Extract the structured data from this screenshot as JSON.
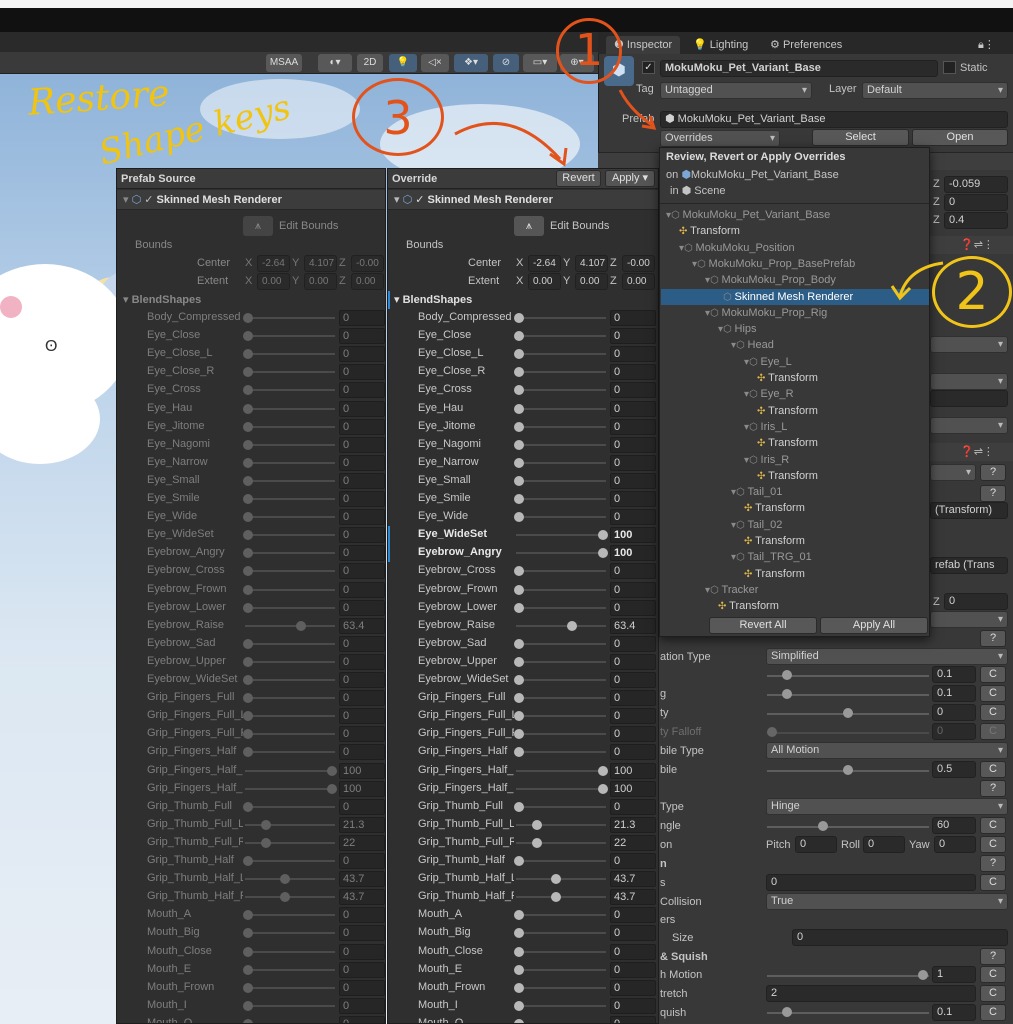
{
  "scene": {
    "toolbar": {
      "msaa": "MSAA",
      "mode_2d": "2D"
    },
    "annotations": {
      "title_line1": "Restore",
      "title_line2": "Shape keys",
      "circle1": "①",
      "circle2": "②",
      "circle3": "③"
    }
  },
  "inspector": {
    "tabs": [
      "Inspector",
      "Lighting",
      "Preferences"
    ],
    "object_name": "MokuMoku_Pet_Variant_Base",
    "static_label": "Static",
    "tag_label": "Tag",
    "tag_value": "Untagged",
    "layer_label": "Layer",
    "layer_value": "Default",
    "prefab_label": "Prefab",
    "prefab_value": "MokuMoku_Pet_Variant_Base",
    "overrides_label": "Overrides",
    "select_label": "Select",
    "open_label": "Open",
    "z_values": [
      "-0.059",
      "0",
      "0.4"
    ],
    "transform_ref_1": "(Transform)",
    "transform_ref_2": "refab (Trans",
    "z_field_label": "Z",
    "z_field_value": "0",
    "rows": [
      {
        "label": "ation Type",
        "dropdown": "Simplified"
      },
      {
        "label": "",
        "value": "0.1"
      },
      {
        "label": "g",
        "value": "0.1"
      },
      {
        "label": "ty",
        "value": "0"
      },
      {
        "label": "ty Falloff",
        "value": "0"
      },
      {
        "label": "bile Type",
        "dropdown": "All Motion"
      },
      {
        "label": "bile",
        "value": "0.5"
      },
      {
        "label": "Type",
        "dropdown": "Hinge"
      },
      {
        "label": "ngle",
        "value": "60"
      },
      {
        "label": "on",
        "pitch": "0",
        "roll": "0",
        "yaw": "0"
      },
      {
        "label": "n"
      },
      {
        "label": "s",
        "value": "0"
      },
      {
        "label": "Collision",
        "dropdown": "True"
      },
      {
        "label": "ers"
      },
      {
        "label": "Size",
        "value": "0"
      },
      {
        "label": "& Squish"
      },
      {
        "label": "h Motion",
        "value": "1"
      },
      {
        "label": "tretch",
        "value": "2"
      },
      {
        "label": "quish",
        "value": "0.1"
      }
    ],
    "pitch_label": "Pitch",
    "roll_label": "Roll",
    "yaw_label": "Yaw",
    "c_label": "C",
    "help": "?"
  },
  "popup": {
    "title": "Review, Revert or Apply Overrides",
    "on_label": "on",
    "on_target": "MokuMoku_Pet_Variant_Base",
    "in_label": "in",
    "in_target": "Scene",
    "tree": [
      {
        "label": "MokuMoku_Pet_Variant_Base",
        "indent": 0,
        "type": "go"
      },
      {
        "label": "Transform",
        "indent": 1,
        "type": "tf"
      },
      {
        "label": "MokuMoku_Position",
        "indent": 1,
        "type": "go"
      },
      {
        "label": "MokuMoku_Prop_BasePrefab",
        "indent": 2,
        "type": "go"
      },
      {
        "label": "MokuMoku_Prop_Body",
        "indent": 3,
        "type": "go"
      },
      {
        "label": "Skinned Mesh Renderer",
        "indent": 4,
        "type": "sel"
      },
      {
        "label": "MokuMoku_Prop_Rig",
        "indent": 3,
        "type": "go"
      },
      {
        "label": "Hips",
        "indent": 4,
        "type": "go"
      },
      {
        "label": "Head",
        "indent": 5,
        "type": "go"
      },
      {
        "label": "Eye_L",
        "indent": 6,
        "type": "go"
      },
      {
        "label": "Transform",
        "indent": 7,
        "type": "tf"
      },
      {
        "label": "Eye_R",
        "indent": 6,
        "type": "go"
      },
      {
        "label": "Transform",
        "indent": 7,
        "type": "tf"
      },
      {
        "label": "Iris_L",
        "indent": 6,
        "type": "go"
      },
      {
        "label": "Transform",
        "indent": 7,
        "type": "tf"
      },
      {
        "label": "Iris_R",
        "indent": 6,
        "type": "go"
      },
      {
        "label": "Transform",
        "indent": 7,
        "type": "tf"
      },
      {
        "label": "Tail_01",
        "indent": 5,
        "type": "go"
      },
      {
        "label": "Transform",
        "indent": 6,
        "type": "tf"
      },
      {
        "label": "Tail_02",
        "indent": 5,
        "type": "go"
      },
      {
        "label": "Transform",
        "indent": 6,
        "type": "tf"
      },
      {
        "label": "Tail_TRG_01",
        "indent": 5,
        "type": "go"
      },
      {
        "label": "Transform",
        "indent": 6,
        "type": "tf"
      },
      {
        "label": "Tracker",
        "indent": 3,
        "type": "go"
      },
      {
        "label": "Transform",
        "indent": 4,
        "type": "tf"
      }
    ],
    "revert_all": "Revert All",
    "apply_all": "Apply All"
  },
  "compare": {
    "source_title": "Prefab Source",
    "override_title": "Override",
    "revert": "Revert",
    "apply": "Apply",
    "component": "Skinned Mesh Renderer",
    "edit_bounds": "Edit Bounds",
    "bounds": "Bounds",
    "center_label": "Center",
    "extent_label": "Extent",
    "x": "X",
    "y": "Y",
    "z": "Z",
    "center": [
      "-2.64",
      "4.107",
      "-0.00"
    ],
    "extent": [
      "0.00",
      "0.00",
      "0.00"
    ],
    "blendshapes_label": "BlendShapes",
    "shapes": [
      {
        "name": "Body_Compressed",
        "src": "0",
        "ovr": "0"
      },
      {
        "name": "Eye_Close",
        "src": "0",
        "ovr": "0"
      },
      {
        "name": "Eye_Close_L",
        "src": "0",
        "ovr": "0"
      },
      {
        "name": "Eye_Close_R",
        "src": "0",
        "ovr": "0"
      },
      {
        "name": "Eye_Cross",
        "src": "0",
        "ovr": "0"
      },
      {
        "name": "Eye_Hau",
        "src": "0",
        "ovr": "0"
      },
      {
        "name": "Eye_Jitome",
        "src": "0",
        "ovr": "0"
      },
      {
        "name": "Eye_Nagomi",
        "src": "0",
        "ovr": "0"
      },
      {
        "name": "Eye_Narrow",
        "src": "0",
        "ovr": "0"
      },
      {
        "name": "Eye_Small",
        "src": "0",
        "ovr": "0"
      },
      {
        "name": "Eye_Smile",
        "src": "0",
        "ovr": "0"
      },
      {
        "name": "Eye_Wide",
        "src": "0",
        "ovr": "0"
      },
      {
        "name": "Eye_WideSet",
        "src": "0",
        "ovr": "100",
        "bold": true
      },
      {
        "name": "Eyebrow_Angry",
        "src": "0",
        "ovr": "100",
        "bold": true
      },
      {
        "name": "Eyebrow_Cross",
        "src": "0",
        "ovr": "0"
      },
      {
        "name": "Eyebrow_Frown",
        "src": "0",
        "ovr": "0"
      },
      {
        "name": "Eyebrow_Lower",
        "src": "0",
        "ovr": "0"
      },
      {
        "name": "Eyebrow_Raise",
        "src": "63.4",
        "ovr": "63.4"
      },
      {
        "name": "Eyebrow_Sad",
        "src": "0",
        "ovr": "0"
      },
      {
        "name": "Eyebrow_Upper",
        "src": "0",
        "ovr": "0"
      },
      {
        "name": "Eyebrow_WideSet",
        "src": "0",
        "ovr": "0"
      },
      {
        "name": "Grip_Fingers_Full",
        "src": "0",
        "ovr": "0"
      },
      {
        "name": "Grip_Fingers_Full_L",
        "src": "0",
        "ovr": "0"
      },
      {
        "name": "Grip_Fingers_Full_R",
        "src": "0",
        "ovr": "0"
      },
      {
        "name": "Grip_Fingers_Half",
        "src": "0",
        "ovr": "0"
      },
      {
        "name": "Grip_Fingers_Half_L",
        "src": "100",
        "ovr": "100"
      },
      {
        "name": "Grip_Fingers_Half_R",
        "src": "100",
        "ovr": "100"
      },
      {
        "name": "Grip_Thumb_Full",
        "src": "0",
        "ovr": "0"
      },
      {
        "name": "Grip_Thumb_Full_L",
        "src": "21.3",
        "ovr": "21.3"
      },
      {
        "name": "Grip_Thumb_Full_R",
        "src": "22",
        "ovr": "22"
      },
      {
        "name": "Grip_Thumb_Half",
        "src": "0",
        "ovr": "0"
      },
      {
        "name": "Grip_Thumb_Half_L",
        "src": "43.7",
        "ovr": "43.7"
      },
      {
        "name": "Grip_Thumb_Half_R",
        "src": "43.7",
        "ovr": "43.7"
      },
      {
        "name": "Mouth_A",
        "src": "0",
        "ovr": "0"
      },
      {
        "name": "Mouth_Big",
        "src": "0",
        "ovr": "0"
      },
      {
        "name": "Mouth_Close",
        "src": "0",
        "ovr": "0"
      },
      {
        "name": "Mouth_E",
        "src": "0",
        "ovr": "0"
      },
      {
        "name": "Mouth_Frown",
        "src": "0",
        "ovr": "0"
      },
      {
        "name": "Mouth_I",
        "src": "0",
        "ovr": "0"
      },
      {
        "name": "Mouth_O",
        "src": "0",
        "ovr": "0"
      }
    ]
  }
}
